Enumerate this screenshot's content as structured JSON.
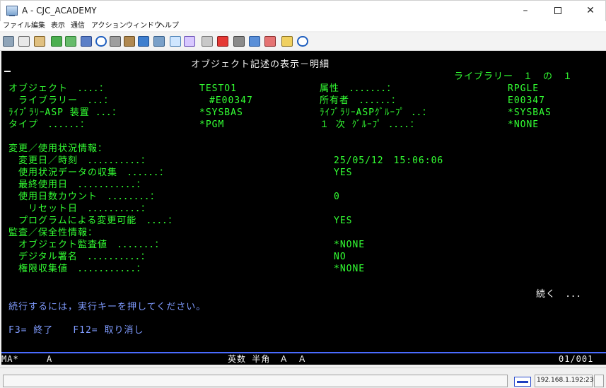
{
  "window": {
    "title": "A - CJC_ACADEMY",
    "minimize": "–",
    "close": "✕"
  },
  "menu": [
    "ファイル",
    "編集",
    "表示",
    "通信",
    "アクション",
    "ウィンドウ",
    "ヘルプ"
  ],
  "toolbar_icons": [
    "print-screen-icon",
    "copy-icon",
    "paste-icon",
    "send-icon",
    "receive-icon",
    "display-icon",
    "clock-icon",
    "keyboard-icon",
    "box-icon",
    "macro-icon",
    "image-icon",
    "grid-icon",
    "tools-icon",
    "record-icon",
    "stop-icon",
    "play-icon",
    "record2-icon",
    "notes-icon",
    "help-icon"
  ],
  "screen": {
    "title": "オブジェクト記述の表示－明細",
    "library_page": "ライブラリー　１　の　１",
    "rows": [
      {
        "label": "オブジェクト　．．．．：",
        "value": "TESTO1",
        "label2": "属性　．．．．．．．：",
        "value2": "RPGLE"
      },
      {
        "label": "　ライブラリー　．．．：",
        "value": "　#E00347",
        "label2": "所有者　．．．．．．：",
        "value2": "E00347"
      },
      {
        "label": "ﾗｲﾌﾞﾗﾘｰASP 装置 ．．．：",
        "value": "*SYSBAS",
        "label2": "ﾗｲﾌﾞﾗﾘｰASPｸﾞﾙｰﾌﾟ ．．：",
        "value2": "*SYSBAS"
      },
      {
        "label": "タイプ　．．．．．．：",
        "value": "*PGM",
        "label2": "１ 次 ｸﾞﾙｰﾌﾟ ．．．．：",
        "value2": "*NONE"
      }
    ],
    "usage_header": "変更／使用状況情報：",
    "usage_rows": [
      {
        "label": "　変更日／時刻　．．．．．．．．．．：",
        "value": "25/05/12　15:06:06"
      },
      {
        "label": "　使用状況データの収集　．．．．．．：",
        "value": "YES"
      },
      {
        "label": "　最終使用日　．．．．．．．．．．．：",
        "value": ""
      },
      {
        "label": "　使用日数カウント　．．．．．．．．：",
        "value": "0"
      },
      {
        "label": "　　リセット日　．．．．．．．．．．：",
        "value": ""
      },
      {
        "label": "　プログラムによる変更可能　．．．．：",
        "value": "YES"
      }
    ],
    "audit_header": "監査／保全性情報：",
    "audit_rows": [
      {
        "label": "　オブジェクト監査値　．．．．．．．：",
        "value": "*NONE"
      },
      {
        "label": "　デジタル署名　．．．．．．．．．．：",
        "value": "NO"
      },
      {
        "label": "　権限収集値　．．．．．．．．．．．：",
        "value": "*NONE"
      }
    ],
    "more": "続く　．．．",
    "message": "続行するには，実行キーを押してください。",
    "function_keys": "F3= 終了　　F12= 取り消し"
  },
  "oia": {
    "left": "MA*",
    "mode": "A",
    "ime": "英数 半角　Ａ　Ａ",
    "position": "01/001"
  },
  "status": {
    "ip": "192.168.1.192:23"
  },
  "colors": {
    "terminal_bg": "#000000",
    "field_green": "#33ff33",
    "title_white": "#f2f2f2",
    "message_blue": "#7f9bff",
    "oia_line": "#4a6bff"
  }
}
